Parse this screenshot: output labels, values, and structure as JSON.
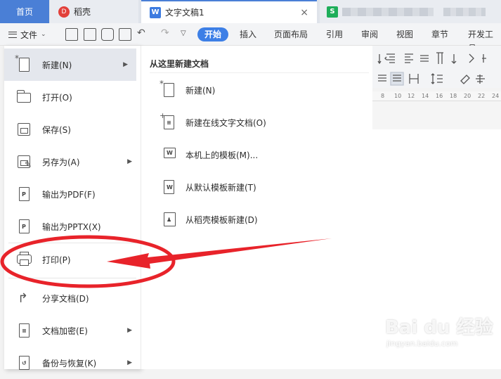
{
  "tabs": {
    "home": "首页",
    "docer": "稻壳",
    "doc": "文字文稿1",
    "doc_close": "×",
    "docer_logo": "D",
    "doc_logo": "W",
    "other_logo": "S"
  },
  "ribbon": {
    "file": "文件",
    "tabs": [
      "开始",
      "插入",
      "页面布局",
      "引用",
      "审阅",
      "视图",
      "章节",
      "开发工具"
    ]
  },
  "file_menu": {
    "items": [
      {
        "label": "新建(N)",
        "icon": "new-doc-icon",
        "submenu": true
      },
      {
        "label": "打开(O)",
        "icon": "folder-icon",
        "submenu": false
      },
      {
        "label": "保存(S)",
        "icon": "save-icon",
        "submenu": false
      },
      {
        "label": "另存为(A)",
        "icon": "save-as-icon",
        "submenu": true
      },
      {
        "label": "输出为PDF(F)",
        "icon": "pdf-icon",
        "submenu": false
      },
      {
        "label": "输出为PPTX(X)",
        "icon": "pptx-icon",
        "submenu": false
      },
      {
        "label": "打印(P)",
        "icon": "print-icon",
        "submenu": false
      },
      {
        "label": "分享文档(D)",
        "icon": "share-icon",
        "submenu": false
      },
      {
        "label": "文档加密(E)",
        "icon": "encrypt-icon",
        "submenu": true
      },
      {
        "label": "备份与恢复(K)",
        "icon": "backup-icon",
        "submenu": true
      }
    ]
  },
  "submenu": {
    "title": "从这里新建文档",
    "items": [
      {
        "label": "新建(N)",
        "icon": "new-doc-icon"
      },
      {
        "label": "新建在线文字文档(O)",
        "icon": "online-doc-icon"
      },
      {
        "label": "本机上的模板(M)...",
        "icon": "local-template-icon"
      },
      {
        "label": "从默认模板新建(T)",
        "icon": "default-template-icon"
      },
      {
        "label": "从稻壳模板新建(D)",
        "icon": "docer-template-icon"
      }
    ]
  },
  "ruler": {
    "ticks": [
      "8",
      "10",
      "12",
      "14",
      "16",
      "18",
      "20",
      "22",
      "24"
    ]
  },
  "watermark": {
    "main": "Bai du 经验",
    "sub": "jingyan.baidu.com"
  },
  "colors": {
    "accent": "#3d7fe6",
    "annotation": "#e8232a",
    "home_tab": "#4a7fd6"
  }
}
